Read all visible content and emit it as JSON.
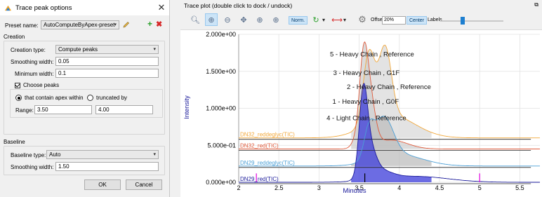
{
  "dialog": {
    "title": "Trace peak options",
    "preset_label": "Preset name:",
    "preset_value": "AutoComputeByApex-preset",
    "creation_group": "Creation",
    "creation_type_label": "Creation type:",
    "creation_type_value": "Compute peaks",
    "smoothing_width_label": "Smoothing width:",
    "smoothing_width_value": "0.05",
    "minimum_width_label": "Minimum width:",
    "minimum_width_value": "0.1",
    "choose_peaks_label": "Choose peaks",
    "contain_apex_label": "that contain apex within",
    "truncated_label": "truncated by",
    "range_label": "Range:",
    "range_from": "3.50",
    "range_to": "4.00",
    "baseline_group": "Baseline",
    "baseline_type_label": "Baseline type:",
    "baseline_type_value": "Auto",
    "baseline_smoothing_label": "Smoothing width:",
    "baseline_smoothing_value": "1.50",
    "ok_label": "OK",
    "cancel_label": "Cancel"
  },
  "plot_window": {
    "title": "Trace plot (double click to dock / undock)",
    "norm_label": "Norm.",
    "offset_label": "Offset",
    "offset_value": "20%",
    "center_label": "Center",
    "labels_label": "Labels",
    "labels_slider_fraction": 0.35
  },
  "chart_data": {
    "type": "area",
    "xlabel": "Minutes",
    "ylabel": "Intensity",
    "xlim": [
      2.0,
      5.75
    ],
    "ylim": [
      0.0,
      2.0
    ],
    "x_ticks": [
      "2",
      "2.5",
      "3",
      "3.5",
      "4",
      "4.5",
      "5",
      "5.5"
    ],
    "y_ticks": [
      "0.000e+00",
      "5.000e-01",
      "1.000e+00",
      "1.500e+00",
      "2.000e+00"
    ],
    "grid": true,
    "traces": [
      {
        "name": "DN32_reddeglyc(TIC)",
        "color": "#f2a83a",
        "fill": "#d9d9d9",
        "offset": 0.6,
        "peaks": [
          [
            3.62,
            0.95,
            0.07
          ],
          [
            3.82,
            0.95,
            0.08
          ],
          [
            3.9,
            0.3,
            0.3
          ]
        ]
      },
      {
        "name": "DN32_red(TIC)",
        "color": "#e05a3a",
        "fill": "#cfcfcf",
        "offset": 0.45,
        "peaks": [
          [
            3.55,
            0.9,
            0.05
          ],
          [
            3.62,
            0.75,
            0.07
          ],
          [
            3.45,
            0.08,
            0.05
          ],
          [
            3.9,
            0.12,
            0.2
          ]
        ]
      },
      {
        "name": "DN29_reddeglyc(TIC)",
        "color": "#4a9fd6",
        "fill": "#bdbdbd",
        "offset": 0.22,
        "peaks": [
          [
            3.62,
            0.35,
            0.06
          ],
          [
            3.8,
            0.55,
            0.12
          ],
          [
            4.0,
            0.15,
            0.3
          ]
        ]
      },
      {
        "name": "DN29_red(TIC)",
        "color": "#1a1a9a",
        "fill": "#3b3bd9",
        "offset": 0.0,
        "peaks": [
          [
            3.55,
            0.98,
            0.05
          ],
          [
            3.62,
            0.4,
            0.08
          ],
          [
            3.75,
            0.12,
            0.15
          ],
          [
            4.2,
            0.08,
            0.4
          ]
        ]
      }
    ],
    "annotations": [
      {
        "text": "5 - Heavy Chain , Reference",
        "x": 3.66,
        "y": 1.7
      },
      {
        "text": "3 - Heavy Chain , G1F",
        "x": 3.59,
        "y": 1.45
      },
      {
        "text": "2 - Heavy Chain , Reference",
        "x": 3.87,
        "y": 1.26
      },
      {
        "text": "1 - Heavy Chain , G0F",
        "x": 3.58,
        "y": 1.06
      },
      {
        "text": "4 - Light Chain , Reference",
        "x": 3.59,
        "y": 0.84
      }
    ],
    "markers": [
      {
        "x": 2.22,
        "color": "#e000e0"
      },
      {
        "x": 5.0,
        "color": "#e000e0"
      },
      {
        "x": 3.57,
        "color": "#000000"
      }
    ]
  }
}
